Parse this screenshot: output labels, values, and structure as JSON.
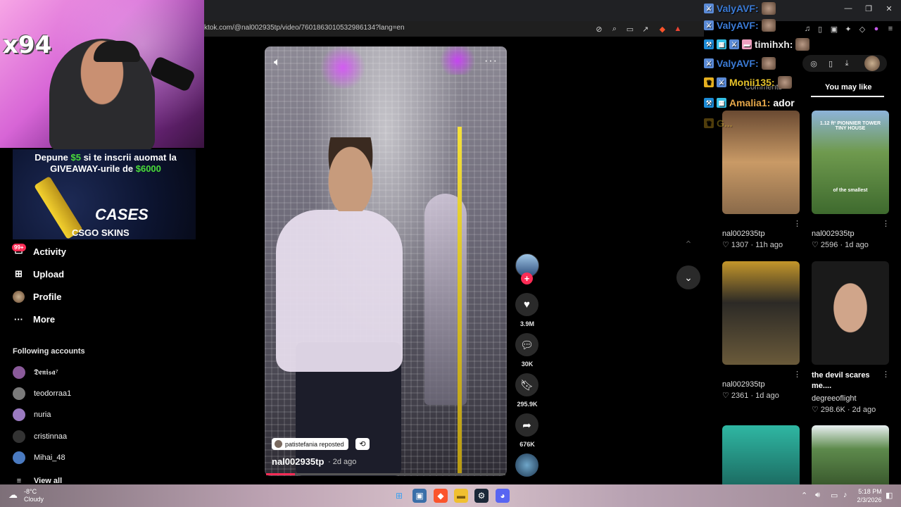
{
  "browser": {
    "url": "ktok.com/@nal002935tp/video/7601863010532986134?lang=en",
    "window_controls": [
      "—",
      "❐",
      "✕"
    ]
  },
  "webcam": {
    "overlay_text": "x94"
  },
  "giveaway": {
    "line1_prefix": "Depune ",
    "line1_amount": "$5",
    "line1_suffix": " si te inscrii auomat la",
    "line2_prefix": "GIVEAWAY-urile de ",
    "line2_amount": "$6000",
    "brand_word": "CASES",
    "brand_sub": "CSGO SKINS"
  },
  "sidebar": {
    "activity_badge": "99+",
    "items": [
      {
        "label": "Activity",
        "icon": "activity-icon",
        "glyph": "▭"
      },
      {
        "label": "Upload",
        "icon": "upload-icon",
        "glyph": "⊞"
      },
      {
        "label": "Profile",
        "icon": "profile-icon",
        "glyph": "●"
      },
      {
        "label": "More",
        "icon": "more-icon",
        "glyph": "···"
      }
    ],
    "following_title": "Following accounts",
    "accounts": [
      {
        "name": "𝕯𝖊𝖓𝖎𝖘𝖆⁷",
        "color": "#8a5a9a"
      },
      {
        "name": "teodorraa1",
        "color": "#7a7a7a"
      },
      {
        "name": "nuria",
        "color": "#9a7ac0"
      },
      {
        "name": "cristinnaa",
        "color": "#333333"
      },
      {
        "name": "Mihai_48",
        "color": "#4a7ac0"
      }
    ],
    "view_all": "View all"
  },
  "video": {
    "repost_label": "patistefania reposted",
    "author": "nal002935tp",
    "date": "· 2d ago",
    "progress": 0.12
  },
  "actions": {
    "likes": "3.9M",
    "comments": "30K",
    "saves": "295.9K",
    "shares": "676K"
  },
  "right_panel": {
    "tab_comments": "Comments",
    "tab_you_may_like": "You may like",
    "cards": [
      {
        "user": "nal002935tp",
        "stats": "♡ 1307 · 11h ago",
        "title": "",
        "thumb_bg": "linear-gradient(180deg,#6a4a32,#c99a66 50%,#8a6a4a)"
      },
      {
        "user": "nal002935tp",
        "stats": "♡ 2596 · 1d ago",
        "title": "",
        "thumb_bg": "linear-gradient(180deg,#8db3d9,#6f9a4e 40%,#3e6a2e)",
        "overlay_top": "1.12 ft² PIONNIER TOWER TINY HOUSE",
        "overlay_mid": "of the smallest"
      },
      {
        "user": "nal002935tp",
        "stats": "♡ 2361 · 1d ago",
        "title": "",
        "thumb_bg": "linear-gradient(180deg,#c4962a,#2c2a26 40%,#6a5a3a)"
      },
      {
        "user": "degreeoflight",
        "stats": "♡ 298.6K · 2d ago",
        "title": "the devil scares me....",
        "thumb_bg": "radial-gradient(ellipse at 50% 45%,#d0a58a 0 30%,#1a1a1a 31%)"
      },
      {
        "user": "",
        "stats": "",
        "title": "",
        "thumb_bg": "linear-gradient(180deg,#2fb7a3,#1c6d63)"
      },
      {
        "user": "",
        "stats": "",
        "title": "",
        "thumb_bg": "linear-gradient(180deg,#e9f0f2,#5d8a4c 40%,#3b5a2e)"
      }
    ]
  },
  "chat": [
    {
      "user": "ValyAVF:",
      "msg": "",
      "color": "#3b7bd6",
      "badges": [
        "mod"
      ]
    },
    {
      "user": "ValyAVF:",
      "msg": "",
      "color": "#3b7bd6",
      "badges": [
        "mod"
      ]
    },
    {
      "user": "timihxh:",
      "msg": "",
      "color": "#e6e6e6",
      "badges": [
        "vip",
        "blue",
        "mod",
        "pink"
      ]
    },
    {
      "user": "ValyAVF:",
      "msg": "",
      "color": "#3b7bd6",
      "badges": [
        "mod"
      ]
    },
    {
      "user": "Monii135:",
      "msg": "",
      "color": "#e6c22a",
      "badges": [
        "crown",
        "mod"
      ]
    },
    {
      "user": "Amalia1:",
      "msg": "ador",
      "color": "#e6a84a",
      "badges": [
        "vip",
        "blue"
      ]
    },
    {
      "user": "G...",
      "msg": "",
      "color": "#e6c22a",
      "badges": [
        "crown"
      ]
    }
  ],
  "taskbar": {
    "temp": "-8°C",
    "weather": "Cloudy",
    "time": "5:18 PM",
    "date": "2/3/2026"
  },
  "colors": {
    "accent": "#fe2c55",
    "bg": "#000000"
  }
}
